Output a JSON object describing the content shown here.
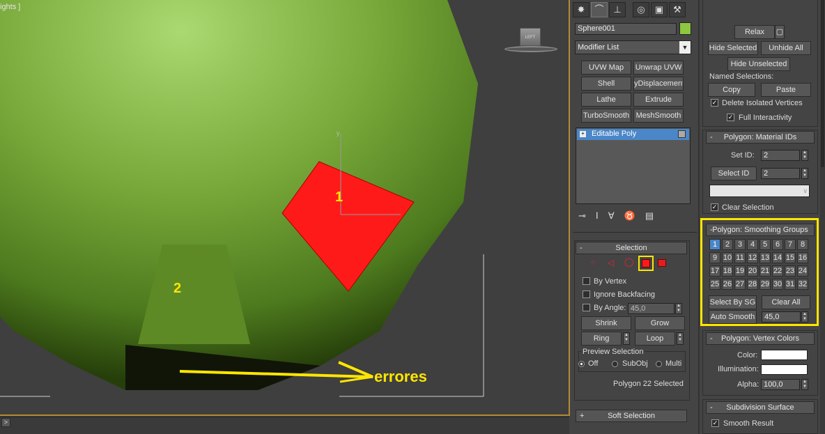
{
  "viewport": {
    "label": "ights ]",
    "axis": "y",
    "viewcube": "LEFT",
    "annotations": {
      "one": "1",
      "two": "2",
      "errors": "errores"
    }
  },
  "timeline": {
    "arrow": ">"
  },
  "tabs": [
    "create-icon",
    "modify-icon",
    "hierarchy-icon",
    "motion-icon",
    "display-icon",
    "utilities-icon"
  ],
  "object": {
    "name": "Sphere001",
    "color": "#8dc63f"
  },
  "modifier_list": {
    "label": "Modifier List"
  },
  "modifier_buttons": [
    "UVW Map",
    "Unwrap UVW",
    "Shell",
    "yDisplacement",
    "Lathe",
    "Extrude",
    "TurboSmooth",
    "MeshSmooth"
  ],
  "stack": {
    "item": "Editable Poly"
  },
  "selection": {
    "title": "Selection",
    "by_vertex": "By Vertex",
    "ignore_backfacing": "Ignore Backfacing",
    "by_angle": "By Angle:",
    "angle_value": "45,0",
    "shrink": "Shrink",
    "grow": "Grow",
    "ring": "Ring",
    "loop": "Loop",
    "preview_title": "Preview Selection",
    "off": "Off",
    "subobj": "SubObj",
    "multi": "Multi",
    "status": "Polygon 22 Selected"
  },
  "soft_selection": {
    "title": "Soft Selection"
  },
  "edit_geometry": {
    "relax": "Relax",
    "hide_selected": "Hide Selected",
    "unhide_all": "Unhide All",
    "hide_unselected": "Hide Unselected",
    "named_selections": "Named Selections:",
    "copy": "Copy",
    "paste": "Paste",
    "delete_isolated": "Delete Isolated Vertices",
    "full_interactivity": "Full Interactivity"
  },
  "material_ids": {
    "title": "Polygon: Material IDs",
    "set_id_label": "Set ID:",
    "set_id_value": "2",
    "select_id": "Select ID",
    "select_id_value": "2",
    "dropdown": "",
    "clear_selection": "Clear Selection"
  },
  "smoothing_groups": {
    "title": "Polygon: Smoothing Groups",
    "groups": [
      "1",
      "2",
      "3",
      "4",
      "5",
      "6",
      "7",
      "8",
      "9",
      "10",
      "11",
      "12",
      "13",
      "14",
      "15",
      "16",
      "17",
      "18",
      "19",
      "20",
      "21",
      "22",
      "23",
      "24",
      "25",
      "26",
      "27",
      "28",
      "29",
      "30",
      "31",
      "32"
    ],
    "active": "1",
    "select_by_sg": "Select By SG",
    "clear_all": "Clear All",
    "auto_smooth": "Auto Smooth",
    "auto_smooth_value": "45,0"
  },
  "vertex_colors": {
    "title": "Polygon: Vertex Colors",
    "color_label": "Color:",
    "illumination_label": "Illumination:",
    "alpha_label": "Alpha:",
    "alpha_value": "100,0"
  },
  "subdivision": {
    "title": "Subdivision Surface",
    "smooth_result": "Smooth Result"
  },
  "colors": {
    "highlight": "#ffe600",
    "selected_poly": "#ff1a1a",
    "stack_selected": "#4a86c8"
  }
}
